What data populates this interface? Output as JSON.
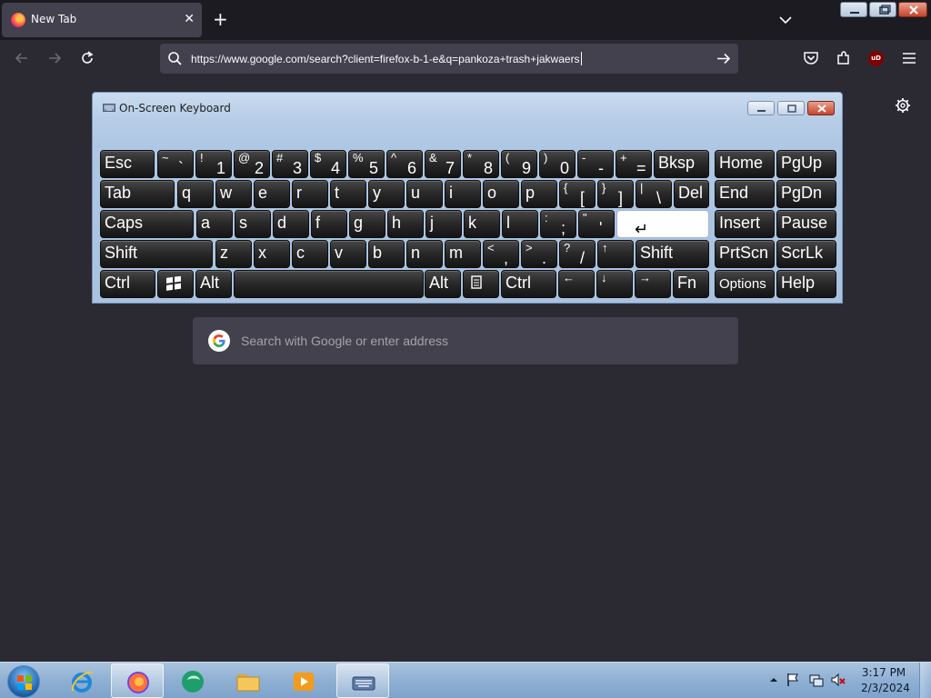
{
  "browser": {
    "tab": {
      "title": "New Tab",
      "favicon": "firefox-icon",
      "close_icon": "close-icon"
    },
    "new_tab_icon": "plus-icon",
    "url": "https://www.google.com/search?client=firefox-b-1-e&q=pankoza+trash+jakwaers",
    "toolbar_icons": [
      "back-icon",
      "forward-icon",
      "reload-icon",
      "pocket-icon",
      "extensions-icon",
      "ublock-icon",
      "menu-icon"
    ],
    "ublock_label": "uD",
    "search_placeholder": "Search with Google or enter address"
  },
  "osk": {
    "title": "On-Screen Keyboard",
    "rows": [
      [
        {
          "id": "esc",
          "main": "Esc"
        },
        {
          "id": "tilde",
          "main": "`",
          "shift": "~"
        },
        {
          "id": "1",
          "main": "1",
          "shift": "!"
        },
        {
          "id": "2",
          "main": "2",
          "shift": "@"
        },
        {
          "id": "3",
          "main": "3",
          "shift": "#"
        },
        {
          "id": "4",
          "main": "4",
          "shift": "$"
        },
        {
          "id": "5",
          "main": "5",
          "shift": "%"
        },
        {
          "id": "6",
          "main": "6",
          "shift": "^"
        },
        {
          "id": "7",
          "main": "7",
          "shift": "&"
        },
        {
          "id": "8",
          "main": "8",
          "shift": "*"
        },
        {
          "id": "9",
          "main": "9",
          "shift": "("
        },
        {
          "id": "0",
          "main": "0",
          "shift": ")"
        },
        {
          "id": "minus",
          "main": "-",
          "shift": "-"
        },
        {
          "id": "equals",
          "main": "=",
          "shift": "+"
        },
        {
          "id": "bksp",
          "main": "Bksp"
        },
        {
          "id": "home",
          "main": "Home"
        },
        {
          "id": "pgup",
          "main": "PgUp"
        }
      ],
      [
        {
          "id": "tab",
          "main": "Tab"
        },
        {
          "id": "q",
          "main": "q"
        },
        {
          "id": "w",
          "main": "w"
        },
        {
          "id": "e",
          "main": "e"
        },
        {
          "id": "r",
          "main": "r"
        },
        {
          "id": "t",
          "main": "t"
        },
        {
          "id": "y",
          "main": "y"
        },
        {
          "id": "u",
          "main": "u"
        },
        {
          "id": "i",
          "main": "i"
        },
        {
          "id": "o",
          "main": "o"
        },
        {
          "id": "p",
          "main": "p"
        },
        {
          "id": "lbracket",
          "main": "[",
          "shift": "{"
        },
        {
          "id": "rbracket",
          "main": "]",
          "shift": "}"
        },
        {
          "id": "backslash",
          "main": "\\",
          "shift": "|"
        },
        {
          "id": "del",
          "main": "Del"
        },
        {
          "id": "end",
          "main": "End"
        },
        {
          "id": "pgdn",
          "main": "PgDn"
        }
      ],
      [
        {
          "id": "caps",
          "main": "Caps"
        },
        {
          "id": "a",
          "main": "a"
        },
        {
          "id": "s",
          "main": "s"
        },
        {
          "id": "d",
          "main": "d"
        },
        {
          "id": "f",
          "main": "f"
        },
        {
          "id": "g",
          "main": "g"
        },
        {
          "id": "h",
          "main": "h"
        },
        {
          "id": "j",
          "main": "j"
        },
        {
          "id": "k",
          "main": "k"
        },
        {
          "id": "l",
          "main": "l"
        },
        {
          "id": "semicolon",
          "main": ";",
          "shift": ":"
        },
        {
          "id": "quote",
          "main": "'",
          "shift": "\""
        },
        {
          "id": "enter",
          "main": "↵"
        },
        {
          "id": "insert",
          "main": "Insert"
        },
        {
          "id": "pause",
          "main": "Pause"
        }
      ],
      [
        {
          "id": "lshift",
          "main": "Shift"
        },
        {
          "id": "z",
          "main": "z"
        },
        {
          "id": "x",
          "main": "x"
        },
        {
          "id": "c",
          "main": "c"
        },
        {
          "id": "v",
          "main": "v"
        },
        {
          "id": "b",
          "main": "b"
        },
        {
          "id": "n",
          "main": "n"
        },
        {
          "id": "m",
          "main": "m"
        },
        {
          "id": "comma",
          "main": ",",
          "shift": "<"
        },
        {
          "id": "period",
          "main": ".",
          "shift": ">"
        },
        {
          "id": "slash",
          "main": "/",
          "shift": "?"
        },
        {
          "id": "up",
          "main": "",
          "shift": "↑"
        },
        {
          "id": "rshift",
          "main": "Shift"
        },
        {
          "id": "prtscn",
          "main": "PrtScn"
        },
        {
          "id": "scrlk",
          "main": "ScrLk"
        }
      ],
      [
        {
          "id": "lctrl",
          "main": "Ctrl"
        },
        {
          "id": "win",
          "main": "",
          "icon": "windows-logo-icon"
        },
        {
          "id": "lalt",
          "main": "Alt"
        },
        {
          "id": "space",
          "main": ""
        },
        {
          "id": "ralt",
          "main": "Alt"
        },
        {
          "id": "menu",
          "main": "",
          "icon": "context-menu-icon"
        },
        {
          "id": "rctrl",
          "main": "Ctrl"
        },
        {
          "id": "left",
          "main": "",
          "shift": "←"
        },
        {
          "id": "down",
          "main": "",
          "shift": "↓"
        },
        {
          "id": "right",
          "main": "",
          "shift": "→"
        },
        {
          "id": "fn",
          "main": "Fn"
        },
        {
          "id": "options",
          "main": "Options"
        },
        {
          "id": "help",
          "main": "Help"
        }
      ]
    ],
    "highlighted_key": "enter"
  },
  "taskbar": {
    "apps": [
      {
        "name": "internet-explorer",
        "icon": "internet-explorer-icon",
        "active": false
      },
      {
        "name": "firefox",
        "icon": "firefox-icon",
        "active": true
      },
      {
        "name": "app-green",
        "icon": "green-app-icon",
        "active": false
      },
      {
        "name": "explorer",
        "icon": "folder-icon",
        "active": false
      },
      {
        "name": "media-player",
        "icon": "media-player-icon",
        "active": false
      },
      {
        "name": "on-screen-keyboard",
        "icon": "keyboard-icon",
        "active": true
      }
    ],
    "tray_icons": [
      "show-hidden-icons-arrow",
      "action-center-flag-icon",
      "network-icon",
      "volume-muted-icon"
    ],
    "time": "3:17 PM",
    "date": "2/3/2024"
  }
}
